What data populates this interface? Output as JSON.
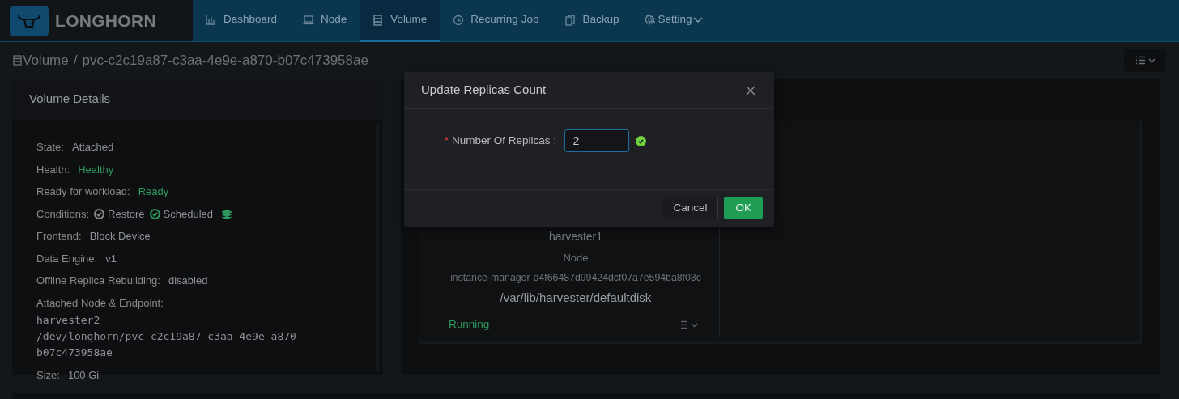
{
  "app": {
    "logo": "LONGHORN"
  },
  "nav": [
    {
      "label": "Dashboard",
      "selected": false,
      "has_menu": false
    },
    {
      "label": "Node",
      "selected": false,
      "has_menu": false
    },
    {
      "label": "Volume",
      "selected": true,
      "has_menu": false
    },
    {
      "label": "Recurring Job",
      "selected": false,
      "has_menu": false
    },
    {
      "label": "Backup",
      "selected": false,
      "has_menu": false
    },
    {
      "label": "Setting",
      "selected": false,
      "has_menu": true
    }
  ],
  "breadcrumb": {
    "section": "Volume",
    "separator": "/",
    "current": "pvc-c2c19a87-c3aa-4e9e-a870-b07c473958ae"
  },
  "volume_details": {
    "title": "Volume Details",
    "fields": [
      {
        "kind": "text",
        "label": "State:",
        "value": "Attached",
        "color": "#8f9194"
      },
      {
        "kind": "text",
        "label": "Health:",
        "value": "Healthy",
        "color": "#2f9a5e"
      },
      {
        "kind": "text",
        "label": "Ready for workload:",
        "value": "Ready",
        "color": "#2f9a5e"
      },
      {
        "kind": "conditions",
        "label": "Conditions:",
        "items": [
          {
            "label": "Restore",
            "color": "#8a8a8a"
          },
          {
            "label": "Scheduled",
            "color": "#2f9a5e"
          }
        ]
      },
      {
        "kind": "text",
        "label": "Frontend:",
        "value": "Block Device",
        "color": "#8f9194"
      },
      {
        "kind": "text",
        "label": "Data Engine:",
        "value": "v1",
        "color": "#8f9194"
      },
      {
        "kind": "text",
        "label": "Offline Replica Rebuilding:",
        "value": "disabled",
        "color": "#8f9194"
      },
      {
        "kind": "endpoint",
        "label": "Attached Node & Endpoint:",
        "lines": [
          "harvester2",
          "/dev/longhorn/pvc-c2c19a87-c3aa-4e9e-a870-",
          "b07c473958ae"
        ]
      },
      {
        "kind": "text",
        "label": "Size:",
        "value": "100 Gi",
        "color": "#8f9194"
      }
    ]
  },
  "replica": {
    "name": "harvester1",
    "node_label": "Node",
    "instance_manager": "instance-manager-d4f66487d99424dcf07a7e594ba8f03c",
    "disk_path": "/var/lib/harvester/defaultdisk",
    "status": "Running"
  },
  "modal": {
    "title": "Update Replicas Count",
    "field": {
      "required_mark": "*",
      "label": "Number Of Replicas",
      "colon": ":",
      "value": "2",
      "valid": true
    },
    "buttons": [
      {
        "label": "Cancel",
        "kind": "default"
      },
      {
        "label": "OK",
        "kind": "primary"
      }
    ]
  }
}
